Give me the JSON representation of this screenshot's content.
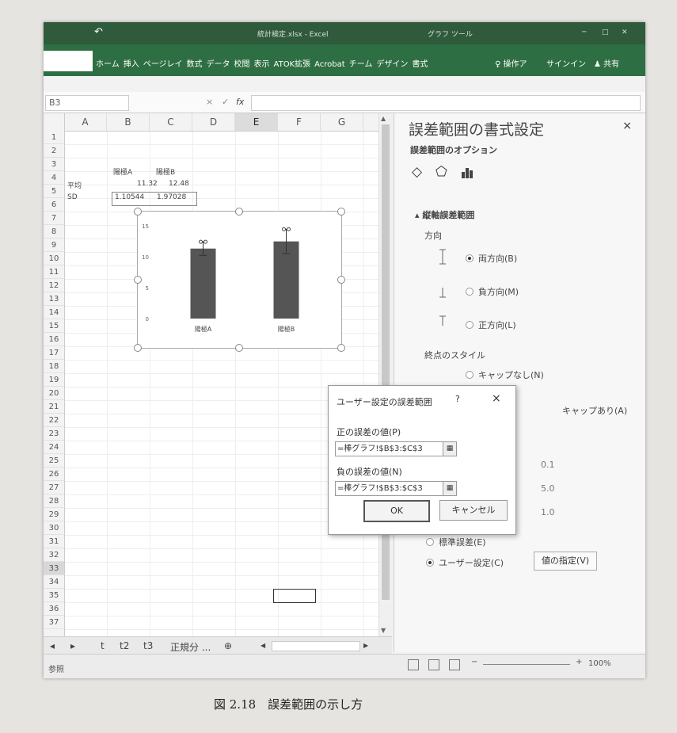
{
  "titlebar": {
    "undo_icon": "undo-icon",
    "filename": "統計検定.xlsx - Excel",
    "context_tab": "グラフ ツール"
  },
  "ribbon": {
    "tabs": [
      "ホーム",
      "挿入",
      "ページレイ",
      "数式",
      "データ",
      "校閲",
      "表示",
      "ATOK拡張",
      "Acrobat",
      "チーム",
      "デザイン",
      "書式"
    ],
    "tell_me": "操作ア",
    "signin": "サインイン",
    "share": "共有"
  },
  "formula_bar": {
    "name_box": "B3",
    "fx": "fx",
    "cancel": "×",
    "enter": "✓"
  },
  "sheet": {
    "columns": [
      "A",
      "B",
      "C",
      "D",
      "E",
      "F",
      "G"
    ],
    "selected_col": "E",
    "rows": [
      "1",
      "2",
      "3",
      "4",
      "5",
      "6",
      "7",
      "8",
      "9",
      "10",
      "11",
      "12",
      "13",
      "14",
      "15",
      "16",
      "17",
      "18",
      "19",
      "20",
      "21",
      "22",
      "23",
      "24",
      "25",
      "26",
      "27",
      "28",
      "29",
      "30",
      "31",
      "32",
      "33",
      "34",
      "35",
      "36",
      "37"
    ],
    "selected_row": "33",
    "cells": {
      "b1": "陽極A",
      "c1": "陽極B",
      "a2": "平均",
      "b2": "11.32",
      "c2": "12.48",
      "a3": "SD",
      "b3": "1.10544",
      "c3": "1.97028"
    }
  },
  "chart_data": {
    "type": "bar",
    "categories": [
      "陽極A",
      "陽極B"
    ],
    "values": [
      11.32,
      12.48
    ],
    "error": [
      1.10544,
      1.97028
    ],
    "ylim": [
      0,
      15
    ],
    "yticks": [
      "0",
      "5",
      "10",
      "15"
    ],
    "bar_color": "#555555"
  },
  "sheet_tabs": {
    "tabs": [
      "t",
      "t2",
      "t3",
      "正規分 ..."
    ],
    "add": "⊕"
  },
  "status": {
    "mode": "参照",
    "zoom": "100%"
  },
  "pane": {
    "title": "誤差範囲の書式設定",
    "close": "×",
    "subtitle": "誤差範囲のオプション",
    "section": "縦軸誤差範囲",
    "direction_label": "方向",
    "directions": [
      "両方向(B)",
      "負方向(M)",
      "正方向(L)"
    ],
    "endstyle_label": "終点のスタイル",
    "endstyle_options": [
      "キャップなし(N)",
      "キャップあり(A)"
    ],
    "amount_values": [
      "0.1",
      "5.0",
      "1.0"
    ],
    "std_error": "標準誤差(E)",
    "custom": "ユーザー設定(C)",
    "specify_button": "値の指定(V)"
  },
  "dialog": {
    "title": "ユーザー設定の誤差範囲",
    "help": "?",
    "close": "×",
    "pos_label": "正の誤差の値(P)",
    "pos_value": "=棒グラフ!$B$3:$C$3",
    "neg_label": "負の誤差の値(N)",
    "neg_value": "=棒グラフ!$B$3:$C$3",
    "ok": "OK",
    "cancel": "キャンセル"
  },
  "caption": "図 2.18　誤差範囲の示し方"
}
